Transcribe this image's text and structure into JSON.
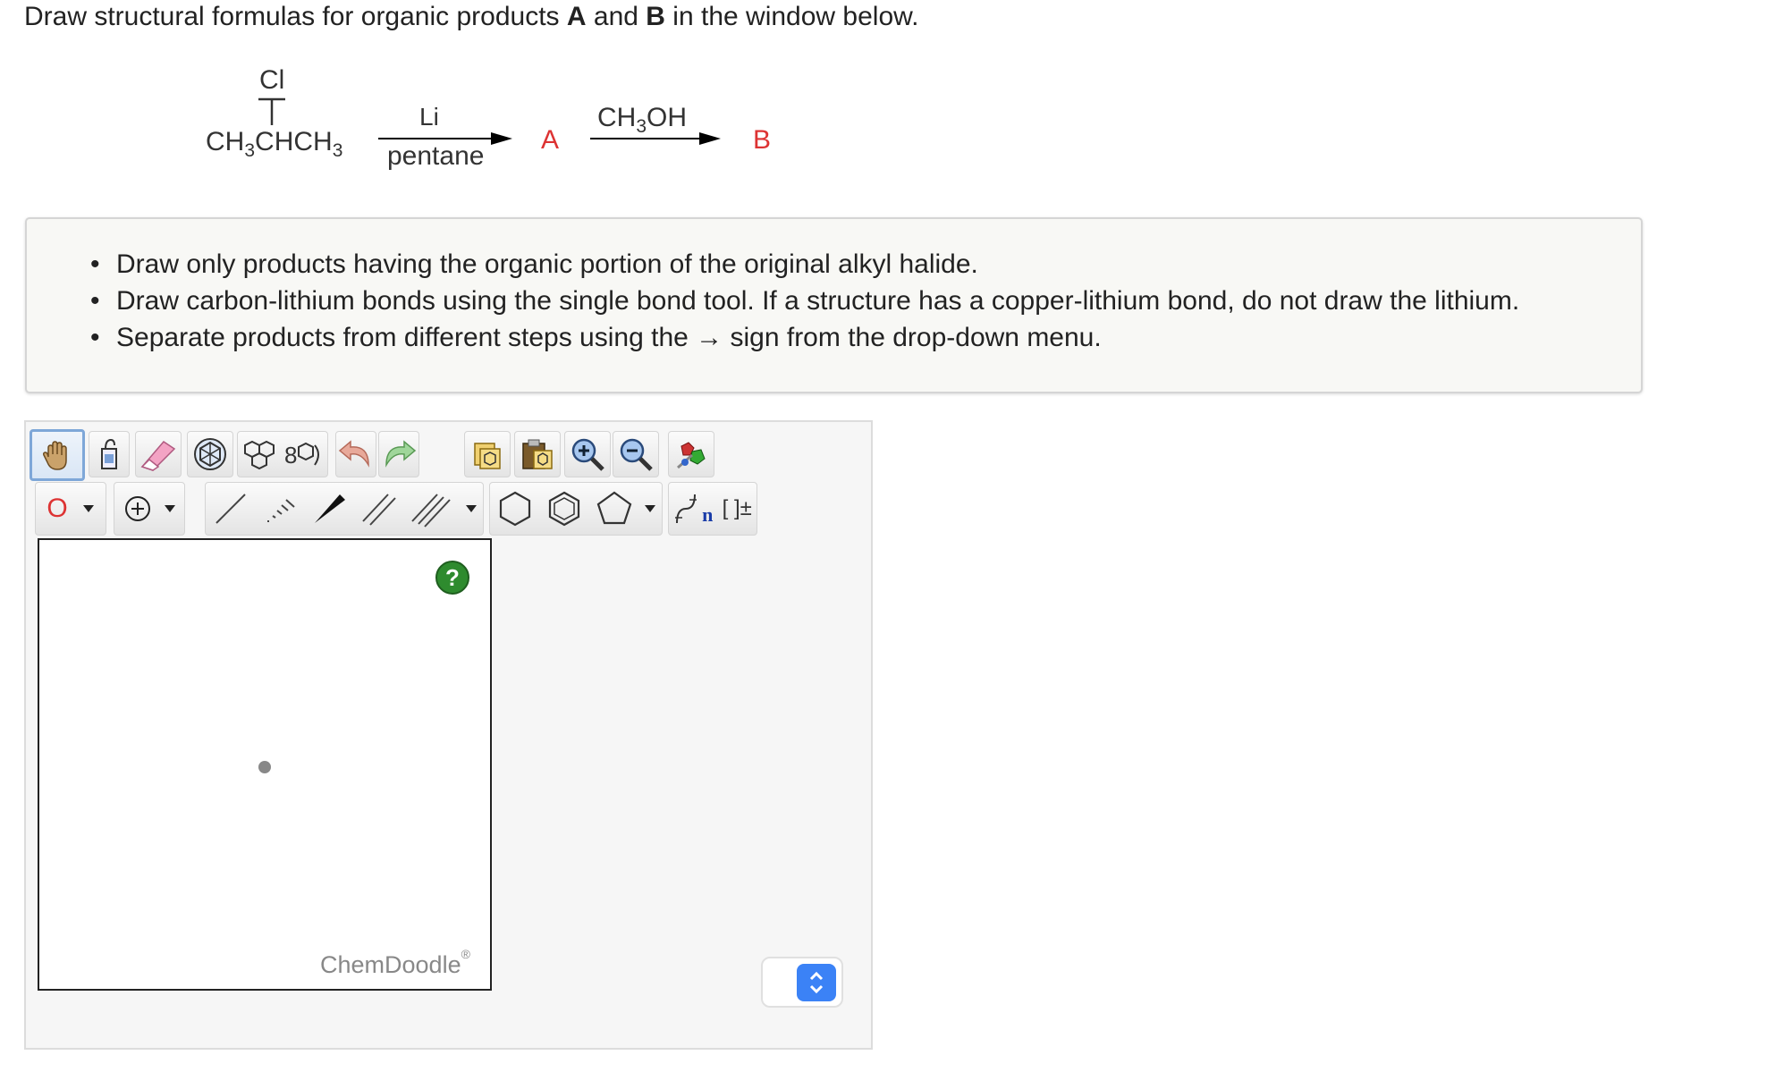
{
  "question": {
    "prefix": "Draw structural formulas for organic products ",
    "label_a": "A",
    "and_word": " and ",
    "label_b": "B",
    "suffix": " in the window below."
  },
  "scheme": {
    "substituent": "Cl",
    "reactant_part1": "CH",
    "reactant_sub1": "3",
    "reactant_part2": "CHCH",
    "reactant_sub2": "3",
    "reagent1_top": "Li",
    "reagent1_bottom": "pentane",
    "product_a": "A",
    "reagent2_part1": "CH",
    "reagent2_sub": "3",
    "reagent2_part2": "OH",
    "product_b": "B",
    "arrow_color": "#000000",
    "label_color": "#d33333"
  },
  "instructions": [
    "Draw only products having the organic portion of the original alkyl halide.",
    "Draw carbon-lithium bonds using the single bond tool. If a structure has a copper-lithium bond, do not draw the lithium.",
    "Separate products from different steps using the → sign from the drop-down menu."
  ],
  "toolbar": {
    "row1": [
      "hand-tool-icon",
      "lasso-tool-icon",
      "eraser-icon",
      "template-icon",
      "ring-template-icon",
      "chain-template-icon",
      "undo-icon",
      "redo-icon",
      "copy-icon",
      "paste-icon",
      "zoom-in-icon",
      "zoom-out-icon",
      "clean-icon"
    ],
    "row2": [
      "atom-selector",
      "charge-selector",
      "single-bond",
      "hashed-bond",
      "wedge-bond",
      "double-bond",
      "triple-bond",
      "benzene-ring",
      "cyclohexane-ring",
      "cyclopentane-ring",
      "sgroup-tool",
      "bracket-tool"
    ],
    "atom_label": "O",
    "sgroup_label": "n",
    "bracket_label": "[ ]±"
  },
  "canvas": {
    "help_label": "?",
    "brand": "ChemDoodle",
    "brand_mark": "®"
  }
}
